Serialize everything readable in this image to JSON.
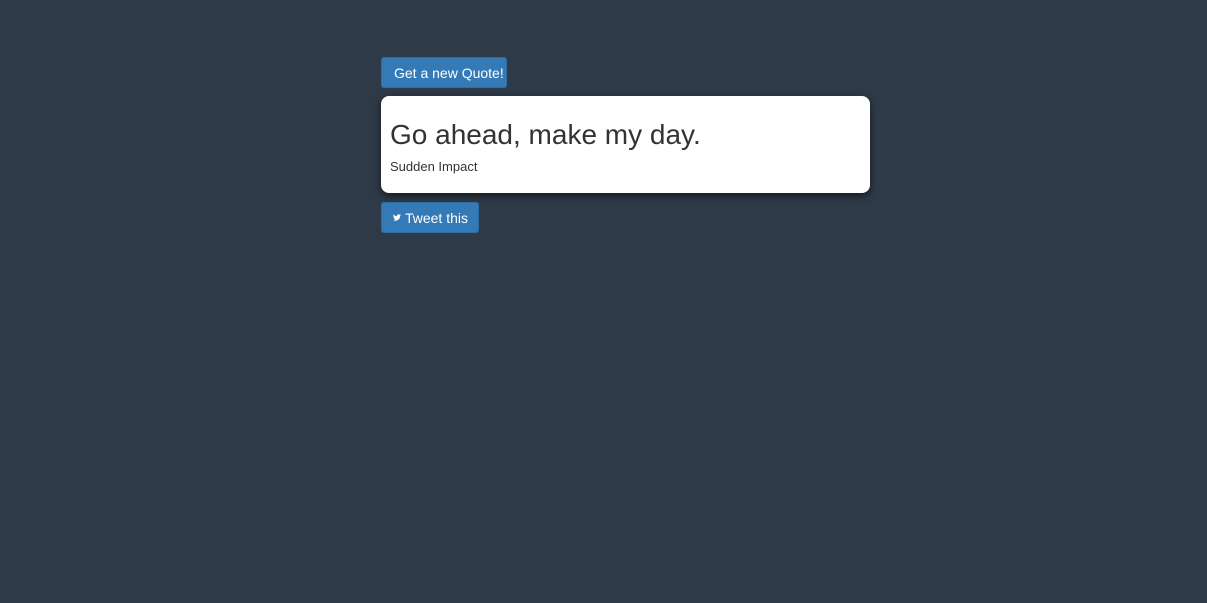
{
  "actions": {
    "new_quote_label": "Get a new Quote!",
    "tweet_label": "Tweet this",
    "tweet_icon": "twitter-icon"
  },
  "quote": {
    "text": "Go ahead, make my day.",
    "source": "Sudden Impact"
  },
  "colors": {
    "background": "#2e3a47",
    "button": "#337ab7",
    "card": "#ffffff",
    "text": "#333333"
  }
}
